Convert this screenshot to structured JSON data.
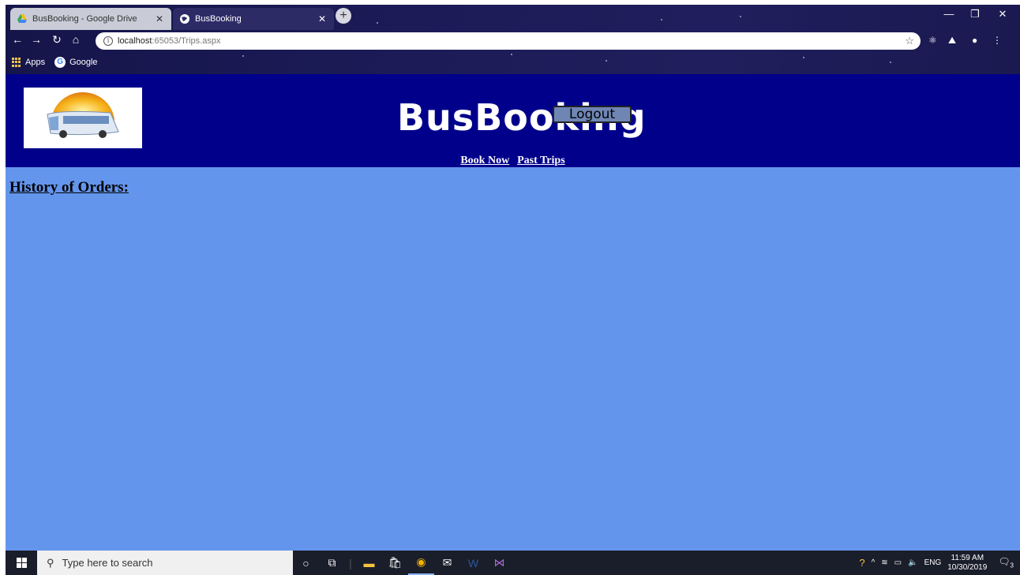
{
  "browser": {
    "tabs": [
      {
        "title": "BusBooking - Google Drive",
        "icon": "google-drive-icon"
      },
      {
        "title": "BusBooking",
        "icon": "globe-icon"
      }
    ],
    "address": {
      "host": "localhost",
      "rest": ":65053/Trips.aspx"
    },
    "bookmarks": [
      {
        "label": "Apps",
        "icon": "apps-grid-icon"
      },
      {
        "label": "Google",
        "icon": "google-icon"
      }
    ]
  },
  "site": {
    "title": "BusBooking",
    "logout_label": "Logout",
    "nav": [
      {
        "label": "Book Now"
      },
      {
        "label": "Past Trips"
      }
    ],
    "section_heading": "History of Orders:"
  },
  "taskbar": {
    "search_placeholder": "Type here to search",
    "language": "ENG",
    "time": "11:59 AM",
    "date": "10/30/2019",
    "notification_count": "3"
  },
  "colors": {
    "header_bg": "#00008b",
    "page_bg": "#6495ed"
  }
}
